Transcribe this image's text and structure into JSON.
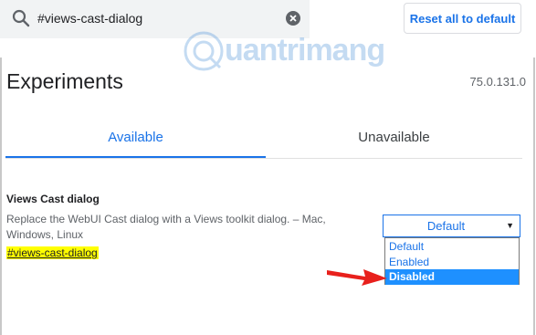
{
  "search": {
    "value": "#views-cast-dialog"
  },
  "header": {
    "reset_label": "Reset all to default"
  },
  "page": {
    "title": "Experiments",
    "version": "75.0.131.0"
  },
  "tabs": [
    {
      "label": "Available",
      "active": true
    },
    {
      "label": "Unavailable",
      "active": false
    }
  ],
  "experiment": {
    "title": "Views Cast dialog",
    "description": "Replace the WebUI Cast dialog with a Views toolkit dialog. – Mac, Windows, Linux",
    "link": "#views-cast-dialog",
    "selected_value": "Default",
    "options": [
      "Default",
      "Enabled",
      "Disabled"
    ],
    "highlighted_option": "Disabled"
  },
  "watermark": {
    "text": "uantrimang"
  },
  "colors": {
    "accent": "#1a73e8",
    "highlight": "#ffff00",
    "option_selected_bg": "#1e90ff",
    "arrow": "#e8201c"
  },
  "icons": {
    "search": "search-icon",
    "clear": "clear-icon",
    "dropdown": "chevron-down-icon",
    "annotation": "red-arrow-icon"
  }
}
